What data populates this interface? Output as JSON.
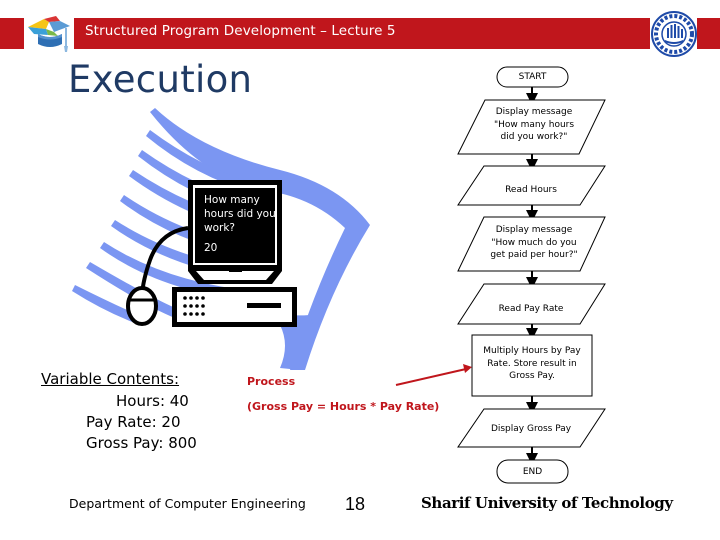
{
  "header": {
    "title": "Structured Program Development – Lecture 5",
    "bar_color": "#c0161c"
  },
  "slide": {
    "title": "Execution",
    "title_color": "#1f3a64"
  },
  "illustration": {
    "screen_question": "How many hours did you work?",
    "screen_answer": "20",
    "swoosh_color": "#7b96f2"
  },
  "flowchart": {
    "nodes": [
      {
        "id": "start",
        "type": "terminal",
        "text": "START"
      },
      {
        "id": "prompt-hours",
        "type": "io",
        "text": "Display message \"How many hours did you work?\""
      },
      {
        "id": "read-hours",
        "type": "io",
        "text": "Read Hours"
      },
      {
        "id": "prompt-rate",
        "type": "io",
        "text": "Display message \"How much do you get paid per hour?\""
      },
      {
        "id": "read-rate",
        "type": "io",
        "text": "Read Pay Rate"
      },
      {
        "id": "multiply",
        "type": "process",
        "text": "Multiply Hours by Pay Rate. Store result in Gross Pay."
      },
      {
        "id": "display-gross",
        "type": "io",
        "text": "Display Gross Pay"
      },
      {
        "id": "end",
        "type": "terminal",
        "text": "END"
      }
    ],
    "edges": [
      [
        "start",
        "prompt-hours"
      ],
      [
        "prompt-hours",
        "read-hours"
      ],
      [
        "read-hours",
        "prompt-rate"
      ],
      [
        "prompt-rate",
        "read-rate"
      ],
      [
        "read-rate",
        "multiply"
      ],
      [
        "multiply",
        "display-gross"
      ],
      [
        "display-gross",
        "end"
      ]
    ]
  },
  "variables": {
    "heading": "Variable Contents:",
    "hours": "Hours: 40",
    "pay_rate": "Pay Rate: 20",
    "gross_pay": "Gross Pay: 800"
  },
  "annotation": {
    "label": "Process",
    "formula": "(Gross Pay = Hours * Pay Rate)",
    "color": "#c0161c",
    "points_to": "multiply"
  },
  "footer": {
    "department": "Department of Computer Engineering",
    "page_number": "18",
    "university": "Sharif University of Technology"
  }
}
